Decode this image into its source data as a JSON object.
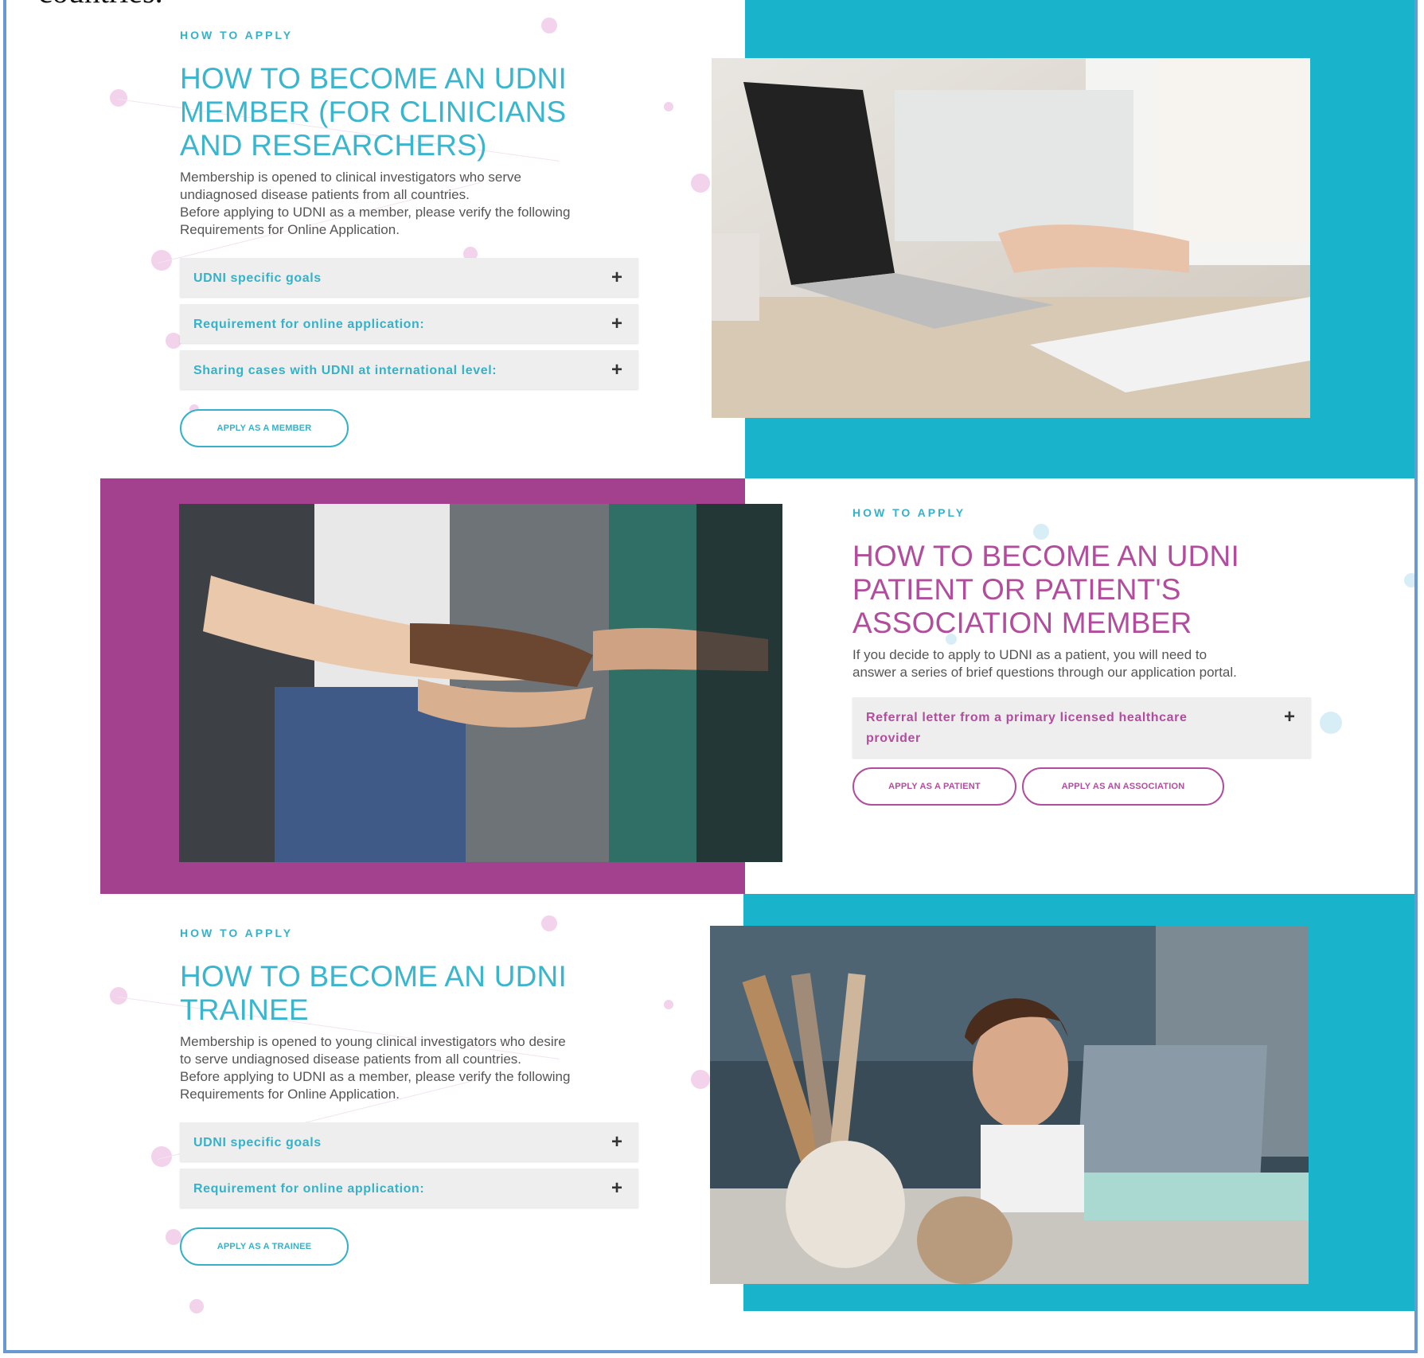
{
  "page_fragment": "countries.",
  "colors": {
    "teal": "#19b4cb",
    "purple": "#a3418f",
    "teal_text": "#35b1c8",
    "purple_text": "#b24d9d"
  },
  "sections": [
    {
      "eyebrow": "HOW TO APPLY",
      "heading_lines": [
        "HOW TO BECOME AN UDNI",
        "MEMBER (FOR CLINICIANS",
        "AND RESEARCHERS)"
      ],
      "description_lines": [
        "Membership is opened to clinical investigators who serve",
        "undiagnosed disease patients from all countries.",
        "Before applying to UDNI as a member, please verify the following",
        "Requirements for Online Application."
      ],
      "accordion": [
        {
          "label": "UDNI specific goals",
          "icon": "plus-icon"
        },
        {
          "label": "Requirement for online application:",
          "icon": "plus-icon"
        },
        {
          "label": "Sharing cases with UDNI at international level:",
          "icon": "plus-icon"
        }
      ],
      "buttons": [
        "APPLY AS A MEMBER"
      ],
      "image": "laptop-typing-photo"
    },
    {
      "eyebrow": "HOW TO APPLY",
      "heading_lines": [
        "HOW TO BECOME AN UDNI",
        "PATIENT OR PATIENT'S",
        "ASSOCIATION MEMBER"
      ],
      "description_lines": [
        "If you decide to apply to UDNI as a patient, you will need to",
        "answer a series of brief questions through our application portal."
      ],
      "accordion": [
        {
          "label_lines": [
            "Referral letter from a primary licensed healthcare",
            "provider"
          ],
          "icon": "plus-icon"
        }
      ],
      "buttons": [
        "APPLY AS A PATIENT",
        "APPLY AS AN ASSOCIATION"
      ],
      "image": "stacked-hands-photo"
    },
    {
      "eyebrow": "HOW TO APPLY",
      "heading_lines": [
        "HOW TO BECOME AN UDNI",
        "TRAINEE"
      ],
      "description_lines": [
        "Membership is opened to young clinical investigators who desire",
        "to serve undiagnosed disease patients from all countries.",
        "Before applying to UDNI as a member, please verify the following",
        "Requirements for Online Application."
      ],
      "accordion": [
        {
          "label": "UDNI specific goals",
          "icon": "plus-icon"
        },
        {
          "label": "Requirement for online application:",
          "icon": "plus-icon"
        }
      ],
      "buttons": [
        "APPLY AS A TRAINEE"
      ],
      "image": "thinking-woman-laptop-photo"
    }
  ]
}
